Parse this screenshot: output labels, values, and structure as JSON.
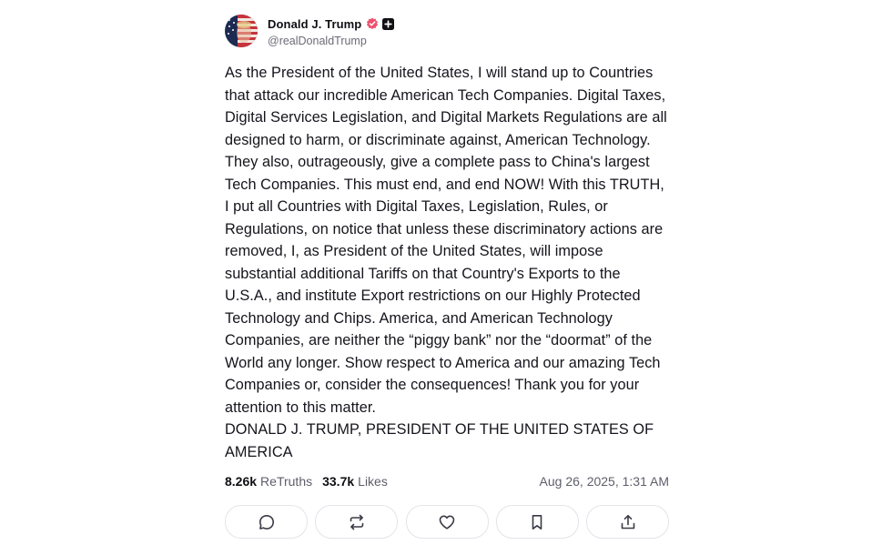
{
  "author": {
    "display_name": "Donald J. Trump",
    "handle": "@realDonaldTrump",
    "verified_icon": "verified-badge-icon",
    "plus_icon": "plus-badge-icon",
    "verified_color": "#f0506e"
  },
  "post": {
    "paragraphs": [
      "As the President of the United States, I will stand up to Countries that attack our incredible American Tech Companies. Digital Taxes, Digital Services Legislation, and Digital Markets Regulations are all designed to harm, or discriminate against, American Technology. They also, outrageously, give a complete pass to China's largest Tech Companies. This must end, and end NOW! With this TRUTH, I put all Countries with Digital Taxes, Legislation, Rules, or Regulations, on notice that unless these discriminatory actions are removed, I, as President of the United States, will impose substantial additional Tariffs on that Country's Exports to the U.S.A., and institute Export restrictions on our Highly Protected Technology and Chips. America, and American Technology Companies, are neither the “piggy bank” nor the “doormat” of the World any longer. Show respect to America and our amazing Tech Companies or, consider the consequences! Thank you for your attention to this matter.",
      "DONALD J. TRUMP, PRESIDENT OF THE UNITED STATES OF AMERICA"
    ]
  },
  "stats": {
    "retruths_count": "8.26k",
    "retruths_label": "ReTruths",
    "likes_count": "33.7k",
    "likes_label": "Likes",
    "timestamp": "Aug 26, 2025, 1:31 AM"
  },
  "actions": [
    {
      "name": "reply-button",
      "icon": "reply-icon"
    },
    {
      "name": "retruth-button",
      "icon": "retruth-icon"
    },
    {
      "name": "like-button",
      "icon": "heart-icon"
    },
    {
      "name": "bookmark-button",
      "icon": "bookmark-icon"
    },
    {
      "name": "share-button",
      "icon": "share-icon"
    }
  ]
}
